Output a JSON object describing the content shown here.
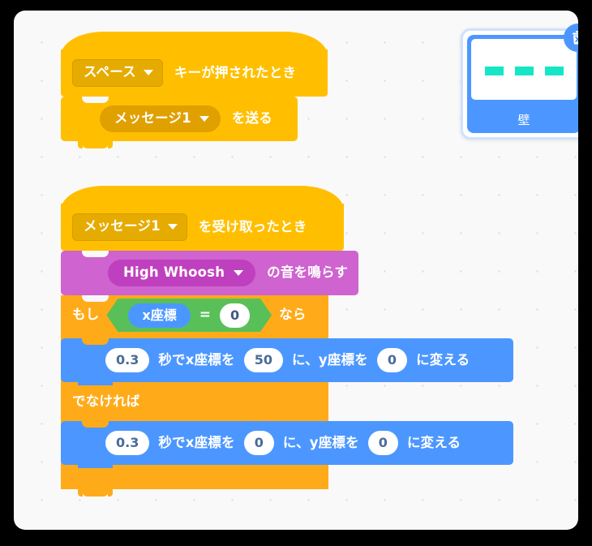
{
  "workspace": {
    "background_color": "#f9f9f9",
    "grid": "dot-grid"
  },
  "scripts": [
    {
      "id": "script-1",
      "blocks": [
        {
          "type": "hat",
          "name": "when-key-pressed",
          "color": "#ffbf00",
          "dropdown_value": "スペース",
          "text_after": "キーが押されたとき"
        },
        {
          "type": "stack",
          "name": "broadcast",
          "color": "#ffbf00",
          "dropdown_value": "メッセージ1",
          "text_after": "を送る"
        }
      ]
    },
    {
      "id": "script-2",
      "blocks": [
        {
          "type": "hat",
          "name": "when-broadcast-received",
          "color": "#ffbf00",
          "dropdown_value": "メッセージ1",
          "text_after": "を受け取ったとき"
        },
        {
          "type": "stack",
          "name": "play-sound",
          "color": "#cf63cf",
          "dropdown_value": "High Whoosh",
          "text_after": "の音を鳴らす"
        },
        {
          "type": "c-block",
          "name": "if-else",
          "color": "#ffab19",
          "if_label": "もし",
          "then_label": "なら",
          "else_label": "でなければ",
          "condition": {
            "name": "equals-operator",
            "color": "#59c059",
            "left_reporter": "x座標",
            "left_color": "#4c97ff",
            "operator": "=",
            "right_value": "0"
          },
          "if_branch": [
            {
              "name": "glide-to-xy",
              "color": "#4c97ff",
              "secs": "0.3",
              "label_secs": "秒でx座標を",
              "x": "50",
              "label_x": "に、y座標を",
              "y": "0",
              "label_y": "に変える"
            }
          ],
          "else_branch": [
            {
              "name": "glide-to-xy",
              "color": "#4c97ff",
              "secs": "0.3",
              "label_secs": "秒でx座標を",
              "x": "0",
              "label_x": "に、y座標を",
              "y": "0",
              "label_y": "に変える"
            }
          ]
        }
      ]
    }
  ],
  "sprite_card": {
    "name": "壁",
    "selected_color": "#4c97ff",
    "border_color": "#cfe2ff",
    "delete_badge": "delete-icon",
    "thumbnail_segments": 3,
    "thumbnail_color": "#15e6c6"
  }
}
